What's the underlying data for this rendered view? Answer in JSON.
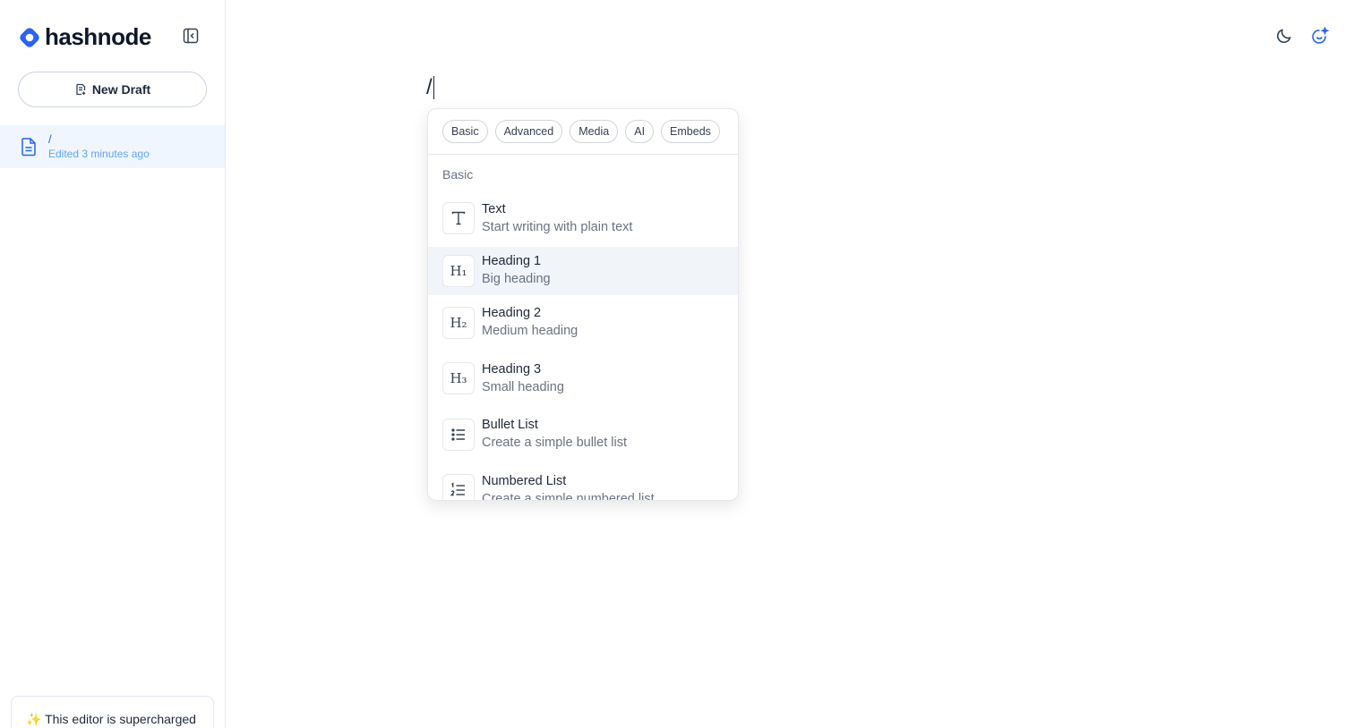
{
  "app": {
    "brand": "hashnode",
    "accent": "#2962ff"
  },
  "sidebar": {
    "new_draft_label": "New Draft",
    "drafts": [
      {
        "title": "/",
        "meta": "Edited 3 minutes ago"
      }
    ],
    "supercharged_text": "✨ This editor is supercharged"
  },
  "editor": {
    "content": "/"
  },
  "slash_menu": {
    "tabs": [
      "Basic",
      "Advanced",
      "Media",
      "AI",
      "Embeds"
    ],
    "section": "Basic",
    "items": [
      {
        "icon": "T",
        "icon_name": "text-icon",
        "title": "Text",
        "desc": "Start writing with plain text"
      },
      {
        "icon": "H₁",
        "icon_name": "heading-1-icon",
        "title": "Heading 1",
        "desc": "Big heading"
      },
      {
        "icon": "H₂",
        "icon_name": "heading-2-icon",
        "title": "Heading 2",
        "desc": "Medium heading"
      },
      {
        "icon": "H₃",
        "icon_name": "heading-3-icon",
        "title": "Heading 3",
        "desc": "Small heading"
      },
      {
        "icon": "",
        "icon_name": "bullet-list-icon",
        "title": "Bullet List",
        "desc": "Create a simple bullet list"
      },
      {
        "icon": "",
        "icon_name": "numbered-list-icon",
        "title": "Numbered List",
        "desc": "Create a simple numbered list"
      }
    ]
  }
}
